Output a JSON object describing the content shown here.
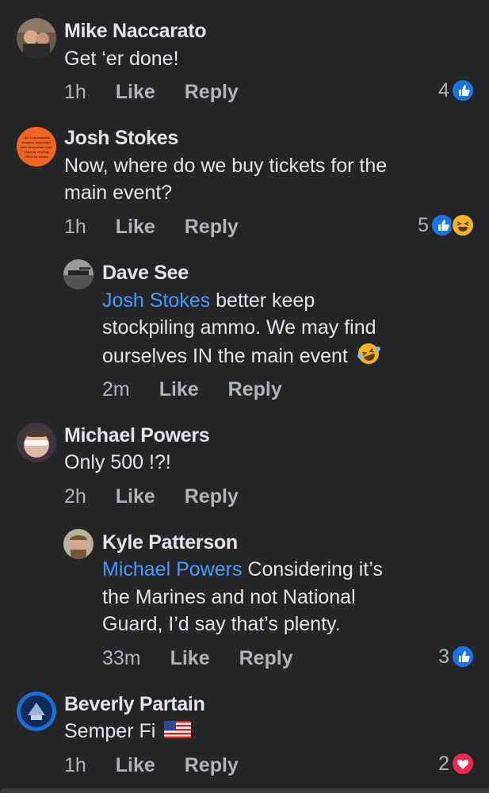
{
  "comments": [
    {
      "name": "Mike Naccarato",
      "text": "Get ‘er done!",
      "time": "1h",
      "like": "Like",
      "reply": "Reply",
      "reaction_count": "4"
    },
    {
      "name": "Josh Stokes",
      "avatar_text": "I die in an industrial accident, know that I died doing what I love: blatantly violating OSHA for funzies",
      "text_line1": "Now, where do we buy tickets for the",
      "text_line2": "main event?",
      "time": "1h",
      "like": "Like",
      "reply": "Reply",
      "reaction_count": "5"
    },
    {
      "name": "Dave See",
      "mention": "Josh Stokes",
      "text_line1": " better keep",
      "text_line2": "stockpiling ammo.  We may find",
      "text_line3": "ourselves IN the main event",
      "time": "2m",
      "like": "Like",
      "reply": "Reply"
    },
    {
      "name": "Michael Powers",
      "text": "Only 500 !?!",
      "time": "2h",
      "like": "Like",
      "reply": "Reply"
    },
    {
      "name": "Kyle Patterson",
      "mention": "Michael Powers",
      "text_line1": " Considering it’s",
      "text_line2": "the Marines and not National",
      "text_line3": "Guard, I’d say that’s plenty.",
      "time": "33m",
      "like": "Like",
      "reply": "Reply",
      "reaction_count": "3"
    },
    {
      "name": "Beverly Partain",
      "text": "Semper Fi",
      "time": "1h",
      "like": "Like",
      "reply": "Reply",
      "reaction_count": "2"
    }
  ],
  "colors": {
    "background": "#242526",
    "mention": "#4599ff",
    "like_reaction": "#1b74e4",
    "love_reaction": "#f0284a",
    "haha_reaction": "#f7b125"
  }
}
